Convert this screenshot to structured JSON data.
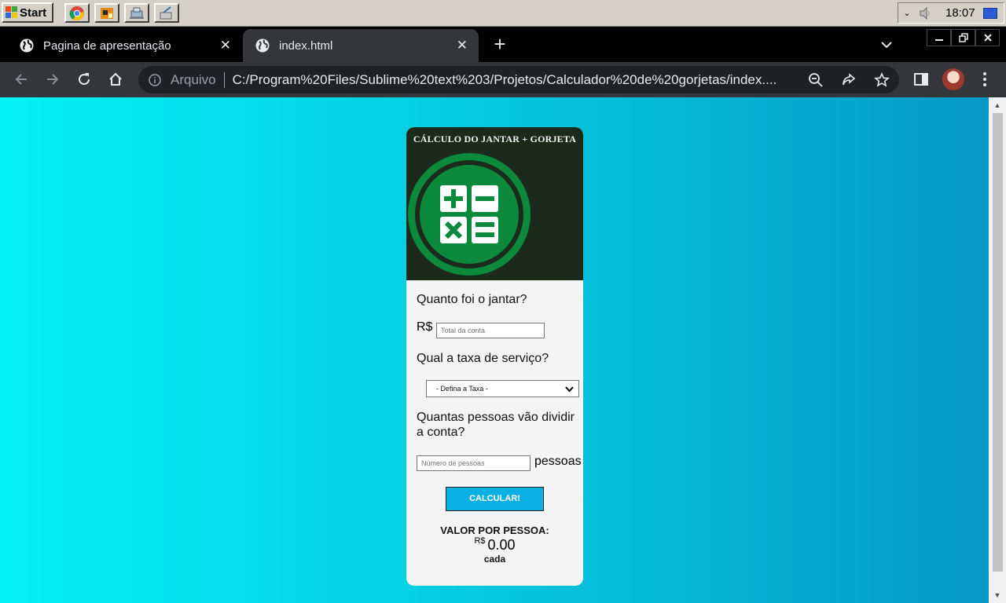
{
  "taskbar": {
    "start_label": "Start",
    "clock": "18:07"
  },
  "browser": {
    "tabs": [
      {
        "title": "Pagina de apresentação",
        "active": false
      },
      {
        "title": "index.html",
        "active": true
      }
    ],
    "omnibox": {
      "label": "Arquivo",
      "url": "C:/Program%20Files/Sublime%20text%203/Projetos/Calculador%20de%20gorjetas/index...."
    }
  },
  "card": {
    "title": "CÁLCULO DO JANTAR + GORJETA",
    "q_dinner": "Quanto foi o jantar?",
    "currency": "R$",
    "bill_placeholder": "Total da conta",
    "q_tax": "Qual a taxa de serviço?",
    "tax_selected": "- Defina a Taxa -",
    "q_people": "Quantas pessoas vão dividir a conta?",
    "people_placeholder": "Número de pessoas",
    "people_suffix": "pessoas",
    "button_label": "CALCULAR!",
    "result_title": "VALOR POR PESSOA:",
    "result_currency": "R$",
    "result_value": "0.00",
    "result_suffix": "cada"
  },
  "colors": {
    "card_header": "#1b2a1a",
    "logo_green": "#0b8a3e",
    "button": "#0bb0e2",
    "bg_left": "#05f3f5",
    "bg_right": "#0598c6"
  }
}
